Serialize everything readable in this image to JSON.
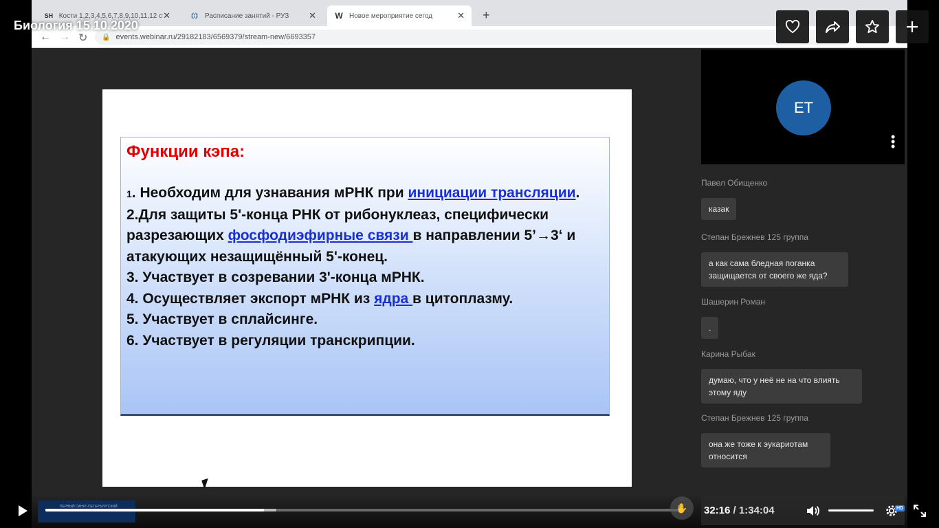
{
  "video": {
    "title": "Биология 15.10.2020",
    "current_time": "32:16",
    "separator": "/",
    "total_time": "1:34:04",
    "progress_fraction": 0.343,
    "buffered_fraction": 0.362,
    "volume_fraction": 1.0,
    "hd_badge": "HD",
    "colors": {
      "accent": "#2e7bea"
    }
  },
  "browser": {
    "tabs": [
      {
        "favicon": "SH",
        "title": "Кости 1,2,3,4,5,6,7,8,9,10,11,12 ст",
        "close": "✕"
      },
      {
        "favicon": "globe-icon",
        "title": "Расписание занятий - РУЗ",
        "close": "✕"
      },
      {
        "favicon": "W",
        "title": "Новое мероприятие сегод",
        "close": "✕"
      }
    ],
    "new_tab": "+",
    "url": "events.webinar.ru/29182183/6569379/stream-new/6693357"
  },
  "slide": {
    "heading": "Функции кэпа:",
    "items": {
      "i1_num": "1",
      "i1_a": ". Необходим для узнавания мРНК при ",
      "i1_link": "инициации трансляции",
      "i1_b": ".",
      "i2_a": "2.Для защиты 5'-конца РНК от рибонуклеаз, специфически разрезающих ",
      "i2_link": "фосфодиэфирные связи ",
      "i2_b": "в направлении 5’→3‘ и атакующих незащищённый 5'-конец.",
      "i3": "3. Участвует в созревании 3'-конца мРНК.",
      "i4_a": "4. Осуществляет экспорт мРНК из ",
      "i4_link": "ядра ",
      "i4_b": "в цитоплазму.",
      "i5": "5. Участвует в сплайсинге.",
      "i6": "6. Участвует в регуляции транскрипции."
    }
  },
  "camera": {
    "initials": "ET",
    "avatar_color": "#1e5fa4"
  },
  "chat": [
    {
      "name": "Павел Обищенко",
      "text": "казак"
    },
    {
      "name": "Степан Брежнев 125 группа",
      "text": "а как сама бледная поганка защищается от своего же яда?"
    },
    {
      "name": "Шашерин Роман",
      "text": "."
    },
    {
      "name": "Карина Рыбак",
      "text": "думаю, что у неё не на что влиять этому яду"
    },
    {
      "name": "Степан Брежнев 125 группа",
      "text": "она же тоже к эукариотам относится"
    }
  ]
}
